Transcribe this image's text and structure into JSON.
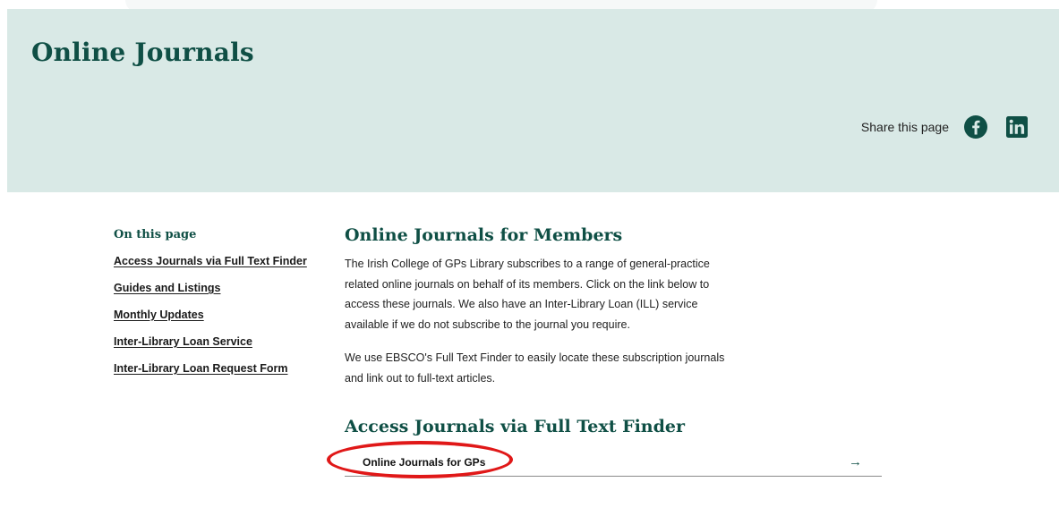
{
  "header": {
    "title": "Online Journals",
    "share_label": "Share this page",
    "share_icons": [
      "facebook-icon",
      "linkedin-icon"
    ],
    "background_color": "#d9e9e6",
    "accent_color": "#0f4f45"
  },
  "sidebar": {
    "heading": "On this page",
    "items": [
      {
        "label": "Access Journals via Full Text Finder"
      },
      {
        "label": "Guides and Listings"
      },
      {
        "label": "Monthly Updates"
      },
      {
        "label": "Inter-Library Loan Service"
      },
      {
        "label": "Inter-Library Loan Request Form"
      }
    ]
  },
  "main": {
    "section1": {
      "title": "Online Journals for Members",
      "paragraphs": [
        "The Irish College of GPs Library subscribes to a range of general-practice related online journals on behalf of its members.  Click on the link below to access these journals. We also have an Inter-Library Loan (ILL) service available if we do not subscribe to the journal you require.",
        "We use EBSCO's Full Text Finder to easily locate these subscription journals and link out to full-text articles."
      ]
    },
    "section2": {
      "title": "Access Journals via Full Text Finder",
      "links": [
        {
          "label": "Online Journals for GPs",
          "arrow": "→",
          "highlighted": true
        }
      ]
    }
  },
  "annotation": {
    "highlight_color": "#e01818"
  }
}
